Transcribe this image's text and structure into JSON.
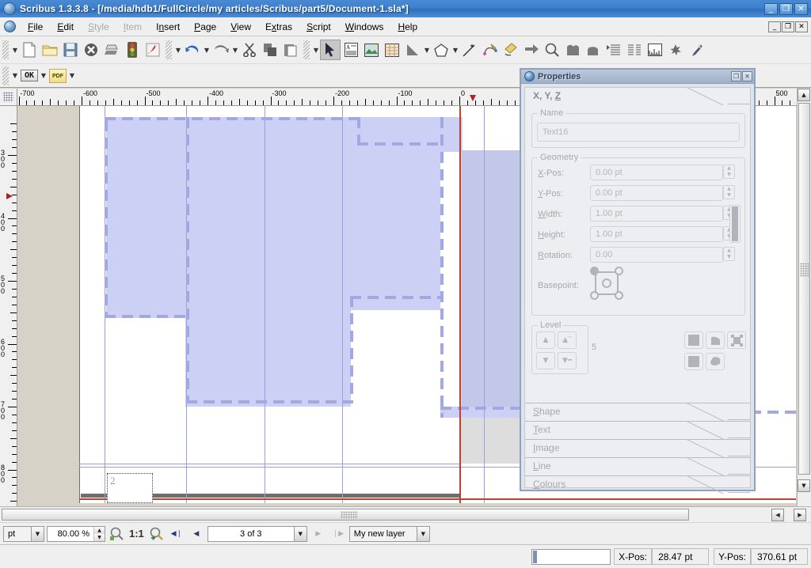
{
  "window": {
    "title": "Scribus 1.3.3.8 - [/media/hdb1/FullCircle/my articles/Scribus/part5/Document-1.sla*]",
    "minimize": "_",
    "maximize": "❐",
    "close": "✕"
  },
  "menu": {
    "items": [
      {
        "label": "File",
        "accel": "F",
        "disabled": false
      },
      {
        "label": "Edit",
        "accel": "E",
        "disabled": false
      },
      {
        "label": "Style",
        "accel": "S",
        "disabled": true
      },
      {
        "label": "Item",
        "accel": "I",
        "disabled": true
      },
      {
        "label": "Insert",
        "accel": "n",
        "disabled": false
      },
      {
        "label": "Page",
        "accel": "P",
        "disabled": false
      },
      {
        "label": "View",
        "accel": "V",
        "disabled": false
      },
      {
        "label": "Extras",
        "accel": "x",
        "disabled": false
      },
      {
        "label": "Script",
        "accel": "S",
        "disabled": false
      },
      {
        "label": "Windows",
        "accel": "W",
        "disabled": false
      },
      {
        "label": "Help",
        "accel": "H",
        "disabled": false
      }
    ],
    "doc_minimize": "_",
    "doc_restore": "❐",
    "doc_close": "✕"
  },
  "toolbar_main": {
    "icons": [
      "new-document-icon",
      "open-folder-icon",
      "save-icon",
      "close-document-icon",
      "print-icon",
      "preflight-verifier-icon",
      "export-pdf-icon",
      "undo-icon",
      "redo-icon"
    ]
  },
  "toolbar_tools": {
    "icons": [
      "cut-icon",
      "copy-icon",
      "paste-icon",
      "select-item-icon",
      "insert-text-frame-icon",
      "insert-image-frame-icon",
      "insert-table-icon",
      "insert-shape-icon",
      "insert-polygon-icon",
      "insert-line-icon",
      "insert-bezier-curve-icon",
      "insert-freehand-line-icon",
      "rotate-item-icon",
      "zoom-icon",
      "edit-contents-icon",
      "edit-text-story-editor-icon",
      "link-text-frames-icon",
      "unlink-text-frames-icon",
      "measurements-icon",
      "copy-item-properties-icon",
      "eye-dropper-icon"
    ]
  },
  "toolbar_pdf": {
    "ok_label": "OK",
    "pdf_label": "PDF",
    "icons": [
      "pdf-tools-icon"
    ]
  },
  "rulers": {
    "unit": "pt",
    "horizontal_labels": [
      "-600",
      "-500",
      "-400",
      "-300",
      "-200",
      "-100",
      "0",
      "500"
    ],
    "vertical_labels": [
      "300",
      "400",
      "500",
      "600",
      "700",
      "800"
    ],
    "h_marker_value": "0",
    "v_marker_value": "370"
  },
  "canvas": {
    "text_frame_label": "2",
    "selected_item": "Text16"
  },
  "properties": {
    "title": "Properties",
    "maximize": "❐",
    "close": "✕",
    "active_tab": "X, Y, Z",
    "active_tab_accel": "Z",
    "name_group": "Name",
    "name_value": "Text16",
    "geometry_group": "Geometry",
    "fields": [
      {
        "label": "X-Pos:",
        "accel": "X",
        "value": "0.00 pt"
      },
      {
        "label": "Y-Pos:",
        "accel": "Y",
        "value": "0.00 pt"
      },
      {
        "label": "Width:",
        "accel": "W",
        "value": "1.00 pt"
      },
      {
        "label": "Height:",
        "accel": "H",
        "value": "1.00 pt"
      },
      {
        "label": "Rotation:",
        "accel": "R",
        "value": "0.00"
      }
    ],
    "basepoint_label": "Basepoint:",
    "basepoint_selected": "top-left",
    "level_group": "Level",
    "level_value": "5",
    "level_buttons": [
      "raise-icon",
      "raise-to-top-icon",
      "lower-icon",
      "lower-to-bottom-icon"
    ],
    "shape_buttons": [
      "flip-horizontal-icon",
      "flip-vertical-icon",
      "lock-icon",
      "lock-size-icon",
      "enable-printing-icon"
    ],
    "tabs": [
      {
        "label": "Shape",
        "accel": "S"
      },
      {
        "label": "Text",
        "accel": "T"
      },
      {
        "label": "Image",
        "accel": "I"
      },
      {
        "label": "Line",
        "accel": "L"
      },
      {
        "label": "Colours",
        "accel": "C"
      }
    ]
  },
  "statusbar": {
    "unit": "pt",
    "zoom": "80.00 %",
    "zoom_out_icon": "zoom-out-icon",
    "ratio": "1:1",
    "zoom_in_icon": "zoom-in-icon",
    "first_page_icon": "◀❘",
    "prev_page_icon": "◀",
    "page_indicator": "3 of 3",
    "next_page_icon": "▶",
    "last_page_icon": "❘▶",
    "layer": "My new layer",
    "xpos_label": "X-Pos:",
    "xpos_value": "28.47 pt",
    "ypos_label": "Y-Pos:",
    "ypos_value": "370.61 pt"
  },
  "colors": {
    "titlebar": "#3d7fcb",
    "selection_fill": "#ccd0f4",
    "selection_dash": "#a3a9e0",
    "page_margin_red": "#c04030",
    "guide": "#9aa0d8",
    "canvas_bg": "#d6d2c8"
  }
}
